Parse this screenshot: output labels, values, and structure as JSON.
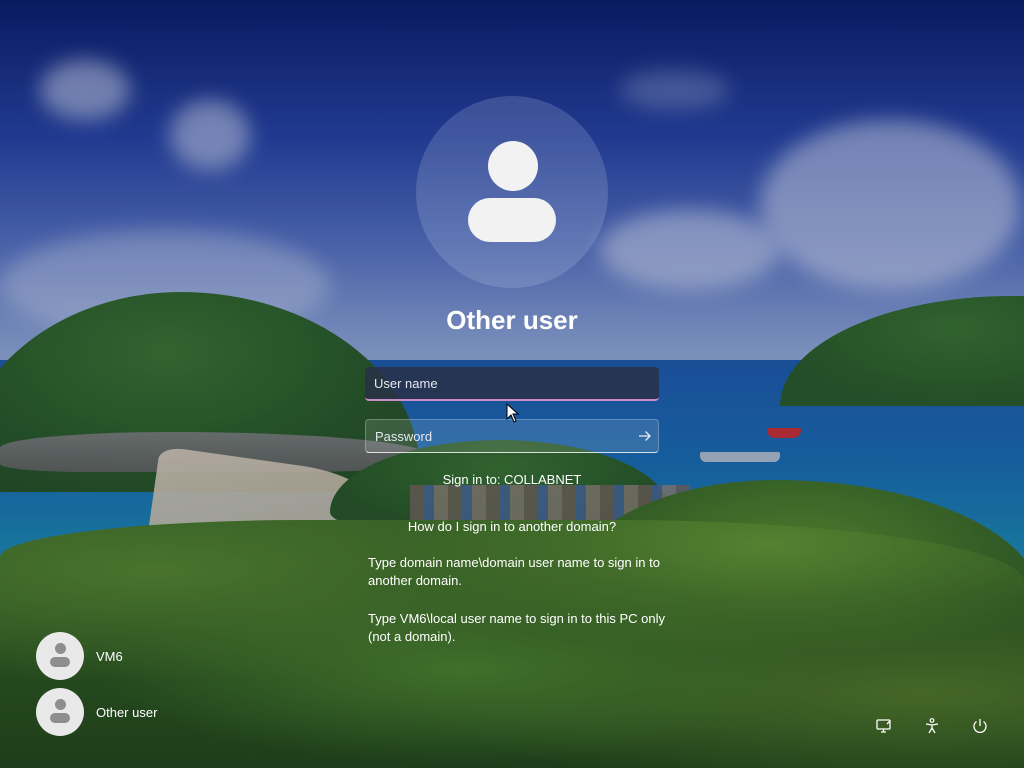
{
  "login": {
    "title": "Other user",
    "username_placeholder": "User name",
    "password_placeholder": "Password",
    "sign_in_to": "Sign in to: COLLABNET",
    "help_link": "How do I sign in to another domain?",
    "help_text_1": "Type domain name\\domain user name to sign in to another domain.",
    "help_text_2": "Type VM6\\local user name to sign in to this PC only (not a domain)."
  },
  "users": [
    {
      "name": "VM6"
    },
    {
      "name": "Other user"
    }
  ],
  "icons": {
    "submit": "arrow-right-icon",
    "network": "network-icon",
    "accessibility": "accessibility-icon",
    "power": "power-icon"
  },
  "colors": {
    "focus_accent": "#c98cc8"
  }
}
